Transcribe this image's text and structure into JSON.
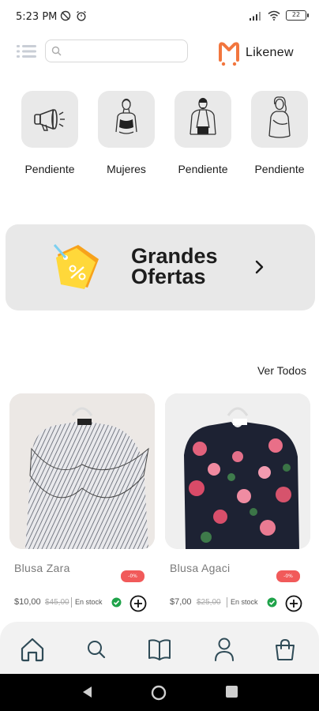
{
  "status_bar": {
    "time": "5:23 PM",
    "battery": "22"
  },
  "header": {
    "search_placeholder": "",
    "brand_name": "Likenew"
  },
  "categories": [
    {
      "label": "Pendiente",
      "icon": "megaphone-icon"
    },
    {
      "label": "Mujeres",
      "icon": "woman-top-icon"
    },
    {
      "label": "Pendiente",
      "icon": "man-jacket-icon"
    },
    {
      "label": "Pendiente",
      "icon": "woman-icon"
    }
  ],
  "banner": {
    "title_line1": "Grandes",
    "title_line2": "Ofertas",
    "icon": "discount-tag-icon"
  },
  "section": {
    "see_all": "Ver Todos"
  },
  "products": [
    {
      "name": "Blusa Zara",
      "discount": "-0%",
      "price": "$10,00",
      "old_price": "$45,00",
      "stock": "En stock"
    },
    {
      "name": "Blusa Agaci",
      "discount": "-0%",
      "price": "$7,00",
      "old_price": "$25,00",
      "stock": "En stock"
    }
  ],
  "bottom_nav": [
    "home-icon",
    "search-icon",
    "book-icon",
    "user-icon",
    "bag-icon"
  ],
  "colors": {
    "accent": "#f2763e",
    "tile_bg": "#e9e9e9",
    "discount_badge": "#f15a5a",
    "in_stock_green": "#1fa34a"
  }
}
